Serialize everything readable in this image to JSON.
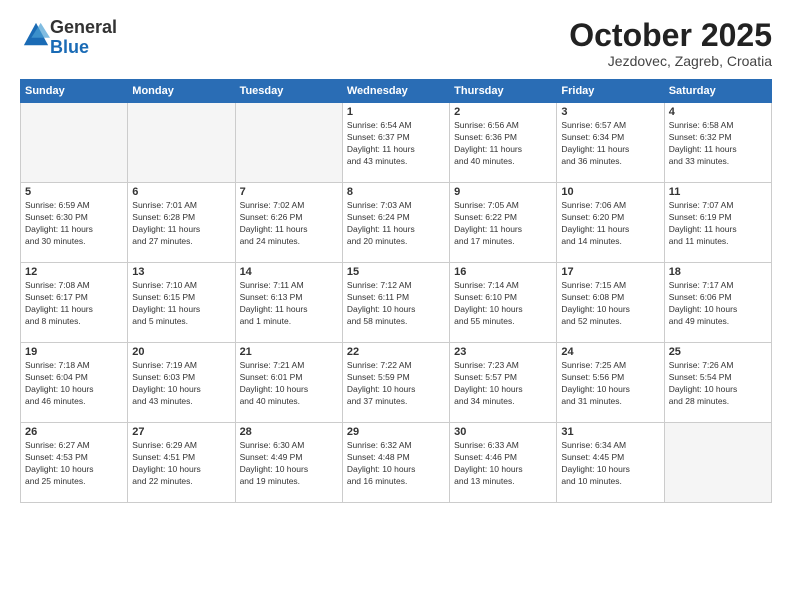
{
  "header": {
    "logo_general": "General",
    "logo_blue": "Blue",
    "month_title": "October 2025",
    "location": "Jezdovec, Zagreb, Croatia"
  },
  "days_of_week": [
    "Sunday",
    "Monday",
    "Tuesday",
    "Wednesday",
    "Thursday",
    "Friday",
    "Saturday"
  ],
  "weeks": [
    [
      {
        "day": "",
        "info": ""
      },
      {
        "day": "",
        "info": ""
      },
      {
        "day": "",
        "info": ""
      },
      {
        "day": "1",
        "info": "Sunrise: 6:54 AM\nSunset: 6:37 PM\nDaylight: 11 hours\nand 43 minutes."
      },
      {
        "day": "2",
        "info": "Sunrise: 6:56 AM\nSunset: 6:36 PM\nDaylight: 11 hours\nand 40 minutes."
      },
      {
        "day": "3",
        "info": "Sunrise: 6:57 AM\nSunset: 6:34 PM\nDaylight: 11 hours\nand 36 minutes."
      },
      {
        "day": "4",
        "info": "Sunrise: 6:58 AM\nSunset: 6:32 PM\nDaylight: 11 hours\nand 33 minutes."
      }
    ],
    [
      {
        "day": "5",
        "info": "Sunrise: 6:59 AM\nSunset: 6:30 PM\nDaylight: 11 hours\nand 30 minutes."
      },
      {
        "day": "6",
        "info": "Sunrise: 7:01 AM\nSunset: 6:28 PM\nDaylight: 11 hours\nand 27 minutes."
      },
      {
        "day": "7",
        "info": "Sunrise: 7:02 AM\nSunset: 6:26 PM\nDaylight: 11 hours\nand 24 minutes."
      },
      {
        "day": "8",
        "info": "Sunrise: 7:03 AM\nSunset: 6:24 PM\nDaylight: 11 hours\nand 20 minutes."
      },
      {
        "day": "9",
        "info": "Sunrise: 7:05 AM\nSunset: 6:22 PM\nDaylight: 11 hours\nand 17 minutes."
      },
      {
        "day": "10",
        "info": "Sunrise: 7:06 AM\nSunset: 6:20 PM\nDaylight: 11 hours\nand 14 minutes."
      },
      {
        "day": "11",
        "info": "Sunrise: 7:07 AM\nSunset: 6:19 PM\nDaylight: 11 hours\nand 11 minutes."
      }
    ],
    [
      {
        "day": "12",
        "info": "Sunrise: 7:08 AM\nSunset: 6:17 PM\nDaylight: 11 hours\nand 8 minutes."
      },
      {
        "day": "13",
        "info": "Sunrise: 7:10 AM\nSunset: 6:15 PM\nDaylight: 11 hours\nand 5 minutes."
      },
      {
        "day": "14",
        "info": "Sunrise: 7:11 AM\nSunset: 6:13 PM\nDaylight: 11 hours\nand 1 minute."
      },
      {
        "day": "15",
        "info": "Sunrise: 7:12 AM\nSunset: 6:11 PM\nDaylight: 10 hours\nand 58 minutes."
      },
      {
        "day": "16",
        "info": "Sunrise: 7:14 AM\nSunset: 6:10 PM\nDaylight: 10 hours\nand 55 minutes."
      },
      {
        "day": "17",
        "info": "Sunrise: 7:15 AM\nSunset: 6:08 PM\nDaylight: 10 hours\nand 52 minutes."
      },
      {
        "day": "18",
        "info": "Sunrise: 7:17 AM\nSunset: 6:06 PM\nDaylight: 10 hours\nand 49 minutes."
      }
    ],
    [
      {
        "day": "19",
        "info": "Sunrise: 7:18 AM\nSunset: 6:04 PM\nDaylight: 10 hours\nand 46 minutes."
      },
      {
        "day": "20",
        "info": "Sunrise: 7:19 AM\nSunset: 6:03 PM\nDaylight: 10 hours\nand 43 minutes."
      },
      {
        "day": "21",
        "info": "Sunrise: 7:21 AM\nSunset: 6:01 PM\nDaylight: 10 hours\nand 40 minutes."
      },
      {
        "day": "22",
        "info": "Sunrise: 7:22 AM\nSunset: 5:59 PM\nDaylight: 10 hours\nand 37 minutes."
      },
      {
        "day": "23",
        "info": "Sunrise: 7:23 AM\nSunset: 5:57 PM\nDaylight: 10 hours\nand 34 minutes."
      },
      {
        "day": "24",
        "info": "Sunrise: 7:25 AM\nSunset: 5:56 PM\nDaylight: 10 hours\nand 31 minutes."
      },
      {
        "day": "25",
        "info": "Sunrise: 7:26 AM\nSunset: 5:54 PM\nDaylight: 10 hours\nand 28 minutes."
      }
    ],
    [
      {
        "day": "26",
        "info": "Sunrise: 6:27 AM\nSunset: 4:53 PM\nDaylight: 10 hours\nand 25 minutes."
      },
      {
        "day": "27",
        "info": "Sunrise: 6:29 AM\nSunset: 4:51 PM\nDaylight: 10 hours\nand 22 minutes."
      },
      {
        "day": "28",
        "info": "Sunrise: 6:30 AM\nSunset: 4:49 PM\nDaylight: 10 hours\nand 19 minutes."
      },
      {
        "day": "29",
        "info": "Sunrise: 6:32 AM\nSunset: 4:48 PM\nDaylight: 10 hours\nand 16 minutes."
      },
      {
        "day": "30",
        "info": "Sunrise: 6:33 AM\nSunset: 4:46 PM\nDaylight: 10 hours\nand 13 minutes."
      },
      {
        "day": "31",
        "info": "Sunrise: 6:34 AM\nSunset: 4:45 PM\nDaylight: 10 hours\nand 10 minutes."
      },
      {
        "day": "",
        "info": ""
      }
    ]
  ]
}
